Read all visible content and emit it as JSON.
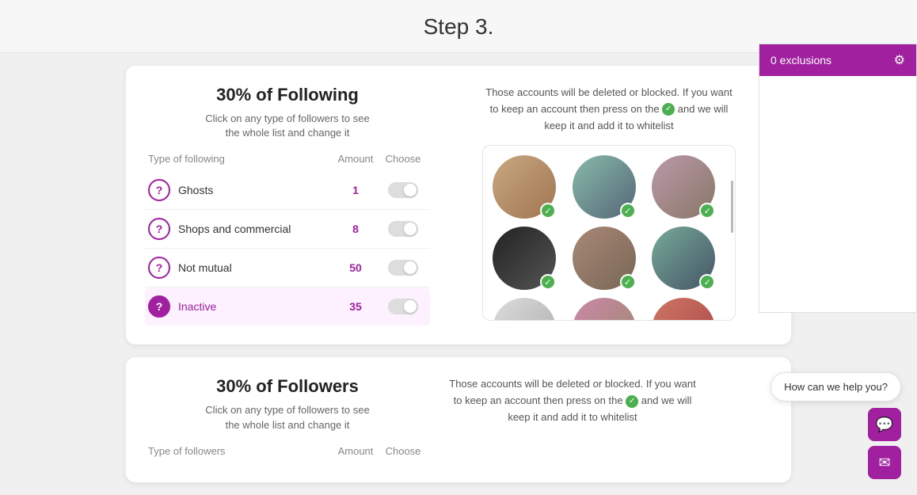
{
  "page": {
    "title": "Step 3."
  },
  "exclusions": {
    "header_label": "0 exclusions",
    "filter_icon": "≡"
  },
  "following_card": {
    "title": "30% of Following",
    "subtitle": "Click on any type of followers to see\nthe whole list and change it",
    "table_headers": {
      "type": "Type of following",
      "amount": "Amount",
      "choose": "Choose"
    },
    "rows": [
      {
        "id": "ghosts",
        "label": "Ghosts",
        "amount": "1",
        "active": false
      },
      {
        "id": "shops",
        "label": "Shops and commercial",
        "amount": "8",
        "active": false
      },
      {
        "id": "not-mutual",
        "label": "Not mutual",
        "amount": "50",
        "active": false
      },
      {
        "id": "inactive",
        "label": "Inactive",
        "amount": "35",
        "active": true
      }
    ],
    "info_text_before": "Those accounts will be deleted or blocked. If you want to keep an account then press on the",
    "info_text_after": "and we will keep it and add it to whitelist",
    "avatars": [
      {
        "id": 1,
        "class": "av1",
        "checked": true
      },
      {
        "id": 2,
        "class": "av2",
        "checked": true
      },
      {
        "id": 3,
        "class": "av3",
        "checked": true
      },
      {
        "id": 4,
        "class": "av4",
        "checked": true
      },
      {
        "id": 5,
        "class": "av5",
        "checked": true
      },
      {
        "id": 6,
        "class": "av6",
        "checked": true
      },
      {
        "id": 7,
        "class": "av7",
        "checked": true
      },
      {
        "id": 8,
        "class": "av8",
        "checked": true
      },
      {
        "id": 9,
        "class": "av9",
        "checked": true
      }
    ]
  },
  "followers_card": {
    "title": "30% of Followers",
    "subtitle": "Click on any type of followers to see\nthe whole list and change it",
    "table_headers": {
      "type": "Type of followers",
      "amount": "Amount",
      "choose": "Choose"
    },
    "info_text_before": "Those accounts will be deleted or blocked. If you want to keep an account then press on the",
    "info_text_after": "and we will keep it and add it to whitelist"
  },
  "chat": {
    "help_text": "How can we help you?",
    "chat_icon": "💬",
    "email_icon": "✉"
  }
}
